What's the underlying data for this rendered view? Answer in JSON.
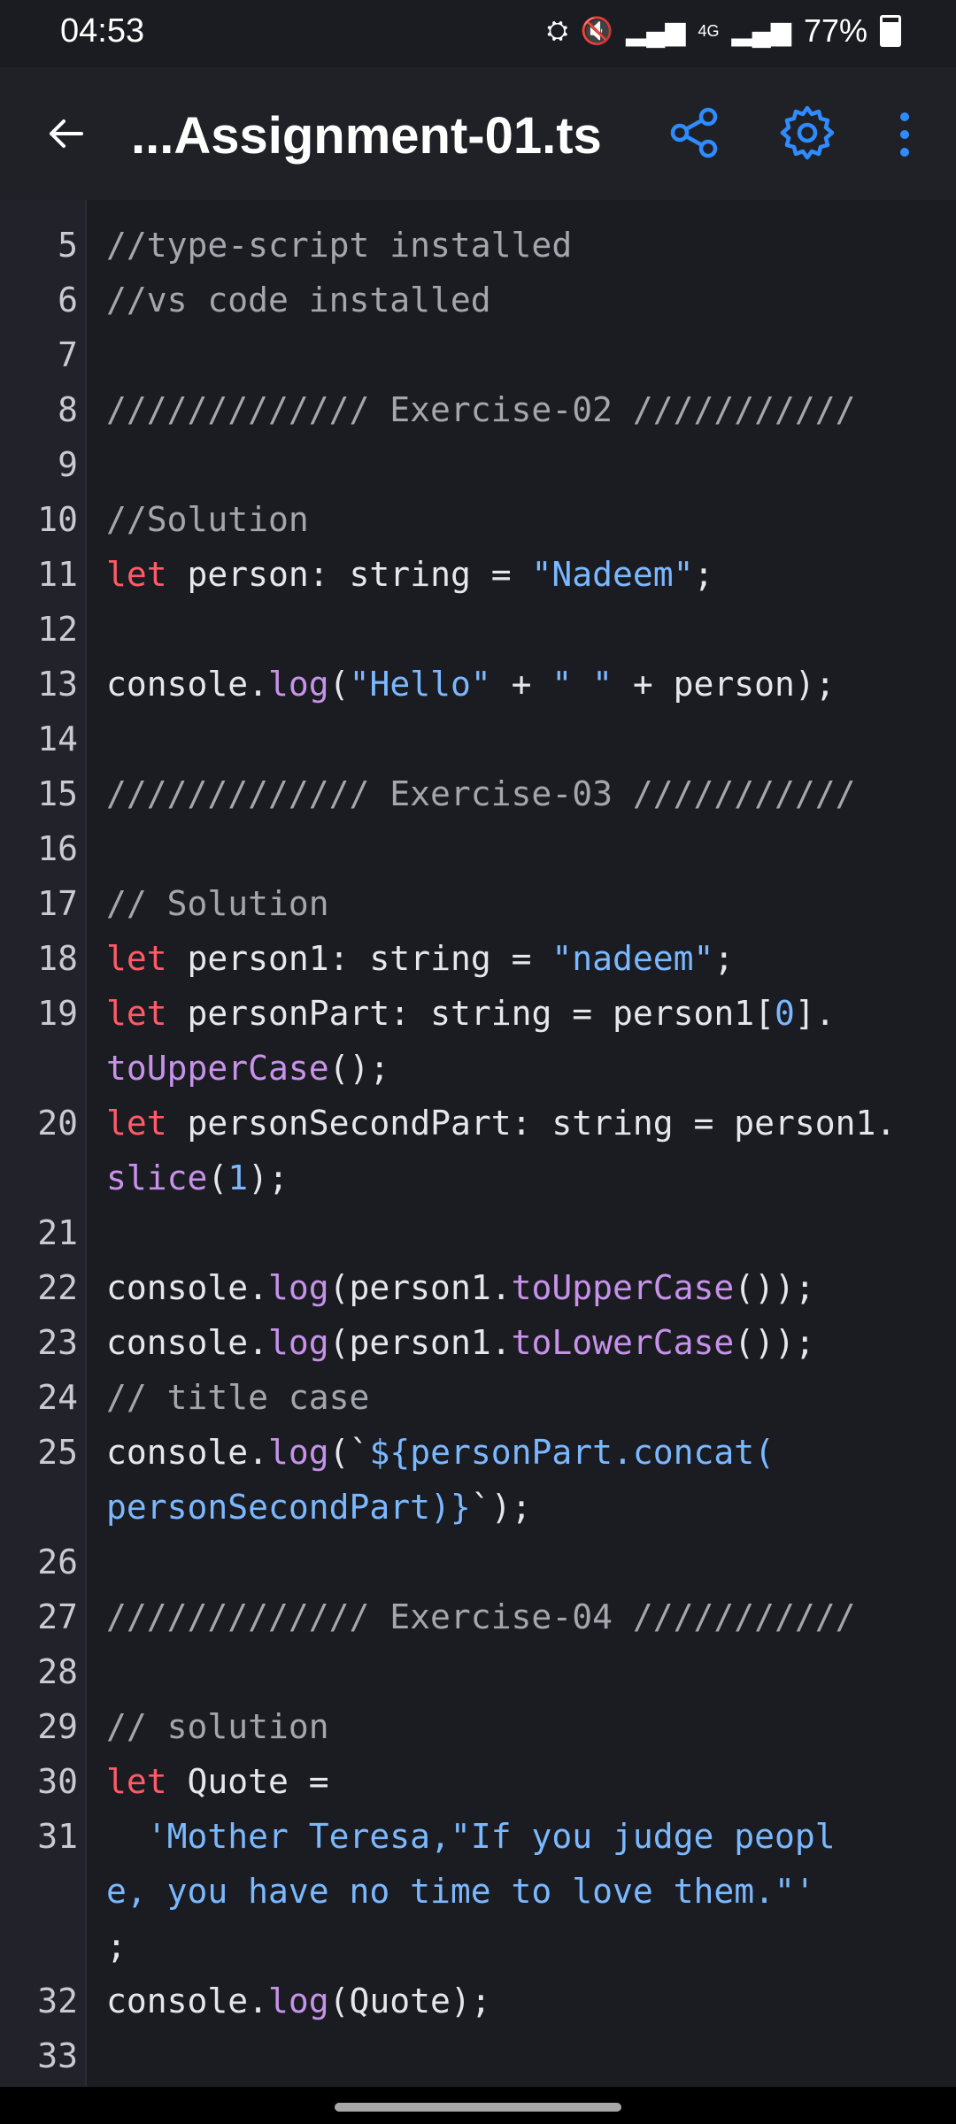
{
  "status": {
    "time": "04:53",
    "battery": "77%",
    "network": "4G"
  },
  "appbar": {
    "title": "...Assignment-01.ts"
  },
  "code": [
    {
      "n": "5",
      "t": [
        [
          "cm",
          "//type-script installed"
        ]
      ]
    },
    {
      "n": "6",
      "t": [
        [
          "cm",
          "//vs code installed"
        ]
      ]
    },
    {
      "n": "7",
      "t": []
    },
    {
      "n": "8",
      "t": [
        [
          "cm",
          "///////////// Exercise-02 ///////////"
        ]
      ]
    },
    {
      "n": "9",
      "t": []
    },
    {
      "n": "10",
      "t": [
        [
          "cm",
          "//Solution"
        ]
      ]
    },
    {
      "n": "11",
      "t": [
        [
          "kw",
          "let"
        ],
        [
          "",
          "person: string = "
        ],
        [
          "str",
          "\"Nadeem\""
        ],
        [
          "",
          ";"
        ]
      ]
    },
    {
      "n": "12",
      "t": []
    },
    {
      "n": "13",
      "t": [
        [
          "",
          "console."
        ],
        [
          "fn",
          "log"
        ],
        [
          "",
          "("
        ],
        [
          "str",
          "\"Hello\""
        ],
        [
          "",
          " + "
        ],
        [
          "str",
          "\" \""
        ],
        [
          "",
          " + person);"
        ]
      ]
    },
    {
      "n": "14",
      "t": []
    },
    {
      "n": "15",
      "t": [
        [
          "cm",
          "///////////// Exercise-03 ///////////"
        ]
      ]
    },
    {
      "n": "16",
      "t": []
    },
    {
      "n": "17",
      "t": [
        [
          "cm",
          "// Solution"
        ]
      ]
    },
    {
      "n": "18",
      "t": [
        [
          "kw",
          "let"
        ],
        [
          "",
          "person1: string = "
        ],
        [
          "str",
          "\"nadeem\""
        ],
        [
          "",
          ";"
        ]
      ]
    },
    {
      "n": "19",
      "t": [
        [
          "kw",
          "let"
        ],
        [
          "",
          "personPart: string = person1["
        ],
        [
          "num",
          "0"
        ],
        [
          "",
          "]."
        ]
      ]
    },
    {
      "n": "",
      "t": [
        [
          "fn",
          "toUpperCase"
        ],
        [
          "",
          "();"
        ]
      ]
    },
    {
      "n": "20",
      "t": [
        [
          "kw",
          "let"
        ],
        [
          "",
          "personSecondPart: string = person1."
        ]
      ]
    },
    {
      "n": "",
      "t": [
        [
          "fn",
          "slice"
        ],
        [
          "",
          "("
        ],
        [
          "num",
          "1"
        ],
        [
          "",
          ");"
        ]
      ]
    },
    {
      "n": "21",
      "t": []
    },
    {
      "n": "22",
      "t": [
        [
          "",
          "console."
        ],
        [
          "fn",
          "log"
        ],
        [
          "",
          "(person1."
        ],
        [
          "fn",
          "toUpperCase"
        ],
        [
          "",
          "());"
        ]
      ]
    },
    {
      "n": "23",
      "t": [
        [
          "",
          "console."
        ],
        [
          "fn",
          "log"
        ],
        [
          "",
          "(person1."
        ],
        [
          "fn",
          "toLowerCase"
        ],
        [
          "",
          "());"
        ]
      ]
    },
    {
      "n": "24",
      "t": [
        [
          "cm",
          "// title case"
        ]
      ]
    },
    {
      "n": "25",
      "t": [
        [
          "",
          "console."
        ],
        [
          "fn",
          "log"
        ],
        [
          "",
          "(`"
        ],
        [
          "str",
          "${personPart.concat("
        ]
      ]
    },
    {
      "n": "",
      "t": [
        [
          "str",
          "personSecondPart)}"
        ],
        [
          "",
          "`);"
        ]
      ]
    },
    {
      "n": "26",
      "t": []
    },
    {
      "n": "27",
      "t": [
        [
          "cm",
          "///////////// Exercise-04 ///////////"
        ]
      ]
    },
    {
      "n": "28",
      "t": []
    },
    {
      "n": "29",
      "t": [
        [
          "cm",
          "// solution"
        ]
      ]
    },
    {
      "n": "30",
      "t": [
        [
          "kw",
          "let"
        ],
        [
          "",
          " Quote ="
        ]
      ]
    },
    {
      "n": "31",
      "t": [
        [
          "",
          "  "
        ],
        [
          "str",
          "'Mother Teresa,\"If you judge peopl"
        ]
      ]
    },
    {
      "n": "",
      "t": [
        [
          "str",
          "e, you have no time to love them.\"'"
        ]
      ]
    },
    {
      "n": "",
      "t": [
        [
          "",
          ";"
        ]
      ]
    },
    {
      "n": "32",
      "t": [
        [
          "",
          "console."
        ],
        [
          "fn",
          "log"
        ],
        [
          "",
          "(Quote);"
        ]
      ]
    },
    {
      "n": "33",
      "t": []
    }
  ]
}
